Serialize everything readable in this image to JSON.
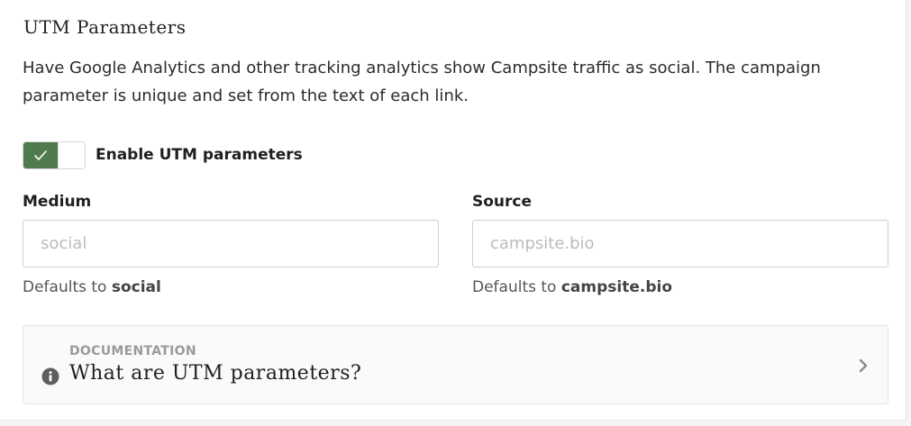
{
  "section": {
    "title": "UTM Parameters",
    "description": "Have Google Analytics and other tracking analytics show Campsite traffic as social. The campaign parameter is unique and set from the text of each link."
  },
  "toggle": {
    "label": "Enable UTM parameters",
    "enabled": true,
    "accent_color": "#4f7b4f"
  },
  "medium": {
    "label": "Medium",
    "value": "",
    "placeholder": "social",
    "help_prefix": "Defaults to ",
    "help_value": "social"
  },
  "source": {
    "label": "Source",
    "value": "",
    "placeholder": "campsite.bio",
    "help_prefix": "Defaults to ",
    "help_value": "campsite.bio"
  },
  "documentation": {
    "kicker": "DOCUMENTATION",
    "title": "What are UTM parameters?",
    "icon": "info-icon",
    "chevron": "chevron-right-icon"
  }
}
